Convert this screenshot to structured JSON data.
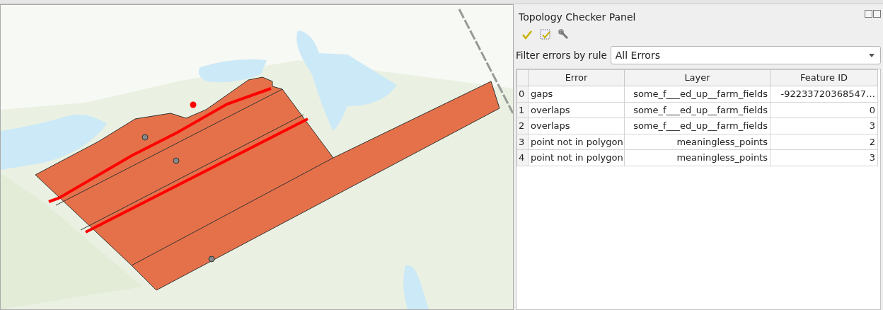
{
  "panel": {
    "title": "Topology Checker Panel",
    "filter": {
      "label": "Filter errors by rule",
      "value": "All Errors"
    }
  },
  "table": {
    "columns": [
      "Error",
      "Layer",
      "Feature ID"
    ],
    "rows": [
      {
        "index": "0",
        "error": "gaps",
        "layer": "some_f___ed_up__farm_fields",
        "feature_id": "-92233720368547…"
      },
      {
        "index": "1",
        "error": "overlaps",
        "layer": "some_f___ed_up__farm_fields",
        "feature_id": "0"
      },
      {
        "index": "2",
        "error": "overlaps",
        "layer": "some_f___ed_up__farm_fields",
        "feature_id": "3"
      },
      {
        "index": "3",
        "error": "point not in polygon",
        "layer": "meaningless_points",
        "feature_id": "2"
      },
      {
        "index": "4",
        "error": "point not in polygon",
        "layer": "meaningless_points",
        "feature_id": "3"
      }
    ]
  }
}
